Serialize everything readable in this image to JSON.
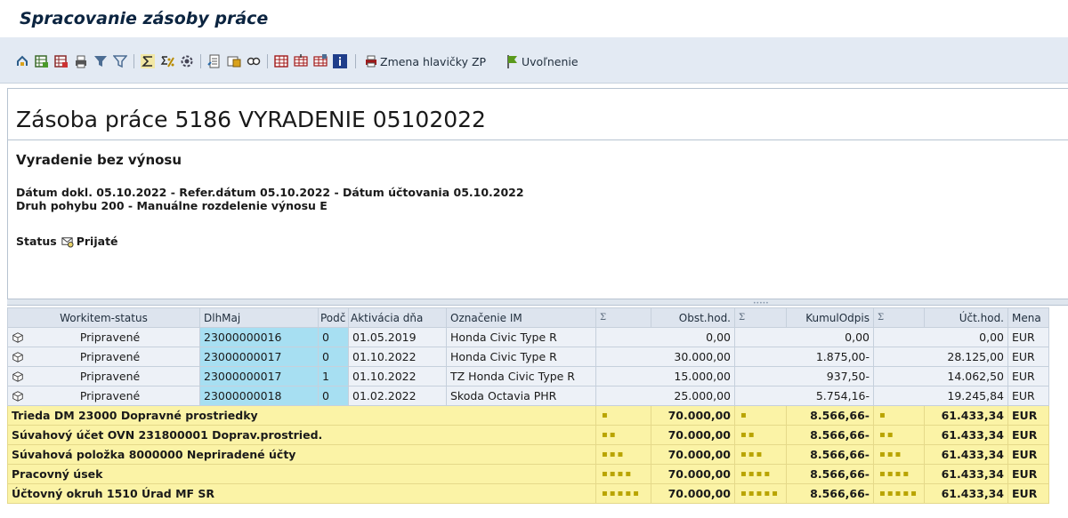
{
  "window": {
    "title": "Spracovanie zásoby práce"
  },
  "toolbar": {
    "icons": [
      "tree-icon",
      "table-add-icon",
      "table-remove-icon",
      "print-icon",
      "filter-icon",
      "filter-off-icon",
      "sum-icon",
      "subtotal-icon",
      "settings-icon",
      "export-icon",
      "mail-icon",
      "find-icon",
      "layout-icon",
      "layout-select-icon",
      "layout-save-icon",
      "info-icon"
    ],
    "buttons": {
      "change_header": "Zmena hlavičky ZP",
      "release": "Uvoľnenie"
    }
  },
  "header": {
    "title": "Zásoba práce 5186 VYRADENIE 05102022",
    "subtitle": "Vyradenie bez výnosu",
    "line1": "Dátum dokl. 05.10.2022 - Refer.dátum 05.10.2022 - Dátum účtovania 05.10.2022",
    "line2": "Druh pohybu 200 - Manuálne rozdelenie výnosu E",
    "status_label": "Status",
    "status_value": "Prijaté"
  },
  "grid": {
    "columns": {
      "workitem_status": "Workitem-status",
      "asset": "DlhMaj",
      "sub": "Podč",
      "activation": "Aktivácia dňa",
      "description": "Označenie IM",
      "sum_marker": "Σ",
      "acq_value": "Obst.hod.",
      "accum_dep": "KumulOdpis",
      "book_value": "Účt.hod.",
      "currency": "Mena"
    },
    "rows": [
      {
        "status": "Pripravené",
        "asset": "23000000016",
        "sub": "0",
        "activation": "01.05.2019",
        "description": "Honda Civic Type R",
        "acq_value": "0,00",
        "accum_dep": "0,00",
        "book_value": "0,00",
        "currency": "EUR"
      },
      {
        "status": "Pripravené",
        "asset": "23000000017",
        "sub": "0",
        "activation": "01.10.2022",
        "description": "Honda Civic Type R",
        "acq_value": "30.000,00",
        "accum_dep": "1.875,00-",
        "book_value": "28.125,00",
        "currency": "EUR"
      },
      {
        "status": "Pripravené",
        "asset": "23000000017",
        "sub": "1",
        "activation": "01.10.2022",
        "description": "TZ Honda Civic Type R",
        "acq_value": "15.000,00",
        "accum_dep": "937,50-",
        "book_value": "14.062,50",
        "currency": "EUR"
      },
      {
        "status": "Pripravené",
        "asset": "23000000018",
        "sub": "0",
        "activation": "01.02.2022",
        "description": "Skoda Octavia PHR",
        "acq_value": "25.000,00",
        "accum_dep": "5.754,16-",
        "book_value": "19.245,84",
        "currency": "EUR"
      }
    ],
    "subtotals": [
      {
        "label": "Trieda DM 23000 Dopravné prostriedky",
        "dots": "▪",
        "acq_value": "70.000,00",
        "accum_dep": "8.566,66-",
        "book_value": "61.433,34",
        "currency": "EUR"
      },
      {
        "label": "Súvahový účet OVN 231800001 Doprav.prostried.",
        "dots": "▪▪",
        "acq_value": "70.000,00",
        "accum_dep": "8.566,66-",
        "book_value": "61.433,34",
        "currency": "EUR"
      },
      {
        "label": "Súvahová položka 8000000 Nepriradené účty",
        "dots": "▪▪▪",
        "acq_value": "70.000,00",
        "accum_dep": "8.566,66-",
        "book_value": "61.433,34",
        "currency": "EUR"
      },
      {
        "label": "Pracovný úsek",
        "dots": "▪▪▪▪",
        "acq_value": "70.000,00",
        "accum_dep": "8.566,66-",
        "book_value": "61.433,34",
        "currency": "EUR"
      },
      {
        "label": "Účtovný okruh 1510 Úrad MF SR",
        "dots": "▪▪▪▪▪",
        "acq_value": "70.000,00",
        "accum_dep": "8.566,66-",
        "book_value": "61.433,34",
        "currency": "EUR"
      }
    ]
  }
}
